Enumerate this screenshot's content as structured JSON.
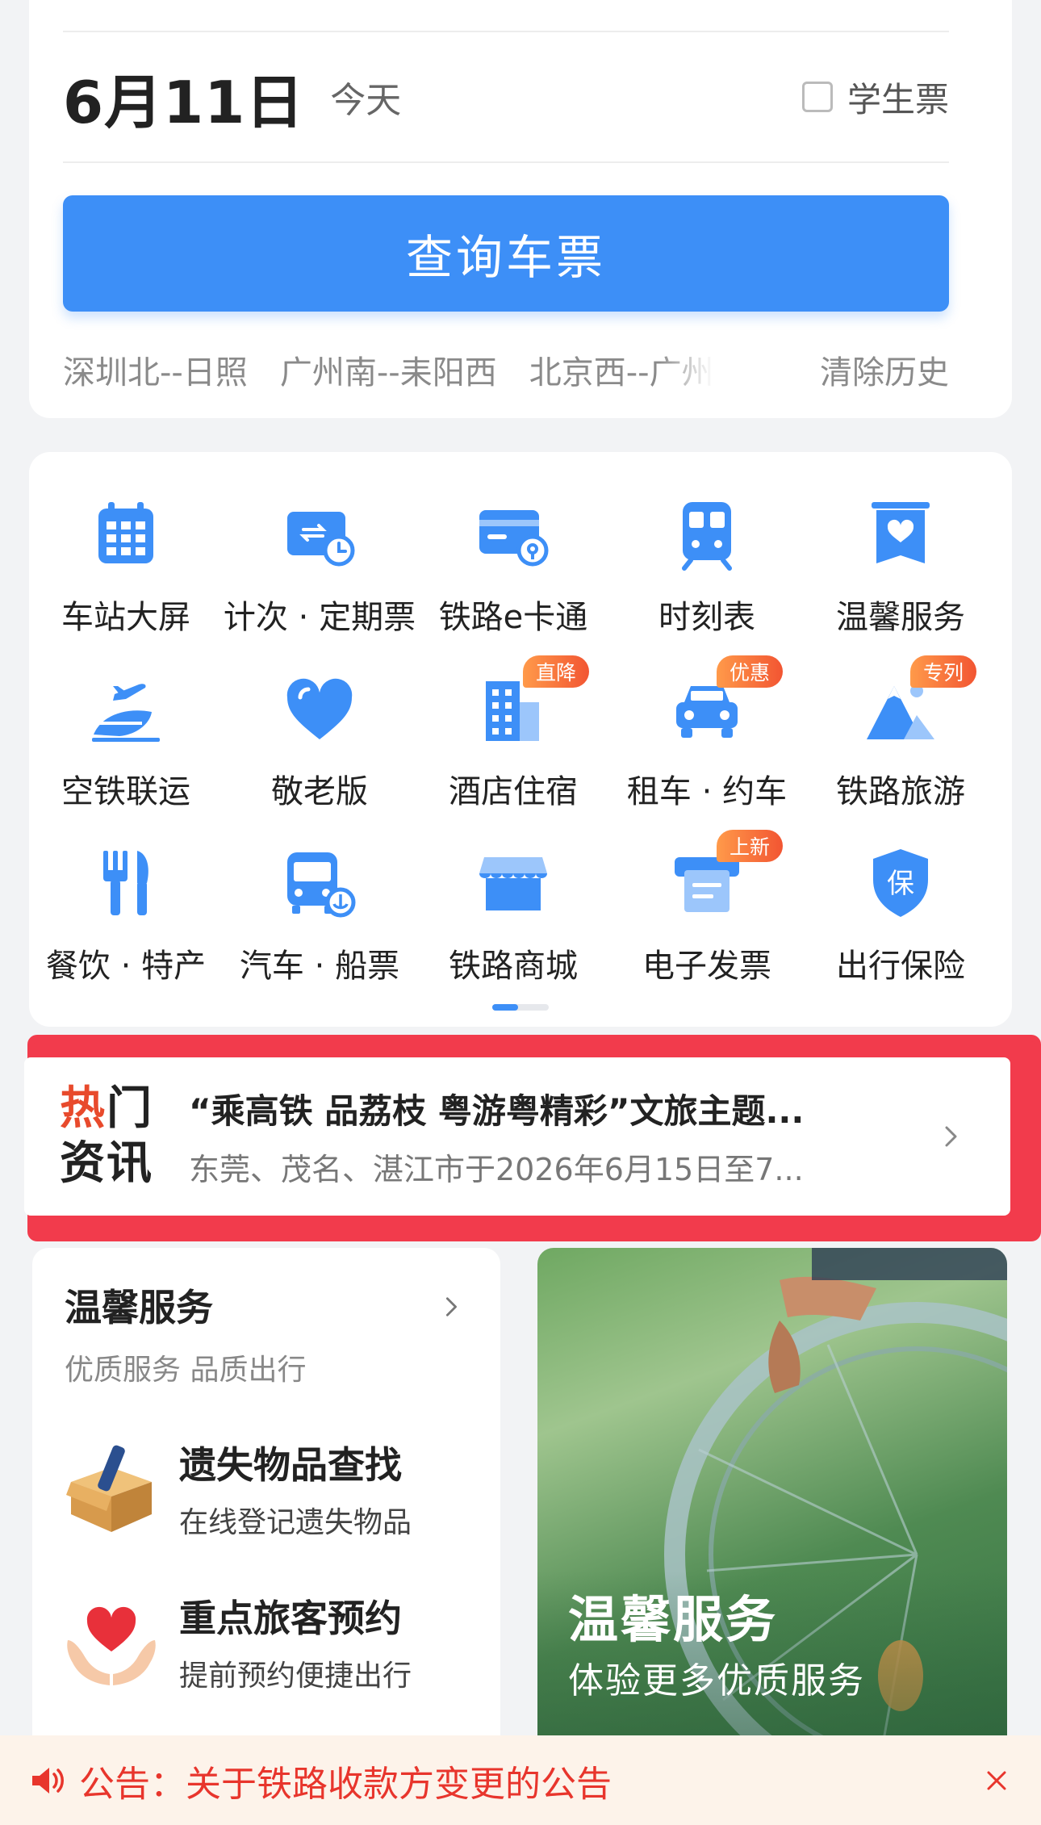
{
  "search_card": {
    "date": "6月11日",
    "date_hint": "今天",
    "student_ticket_label": "学生票",
    "student_ticket_checked": false,
    "search_button": "查询车票",
    "history": [
      "深圳北--日照",
      "广州南--耒阳西",
      "北京西--广州"
    ],
    "clear_history": "清除历史"
  },
  "service_grid": {
    "accent_color": "#3d8ff7",
    "items": [
      {
        "label": "车站大屏",
        "icon": "station-screen-icon"
      },
      {
        "label": "计次 · 定期票",
        "icon": "ticket-wallet-icon"
      },
      {
        "label": "铁路e卡通",
        "icon": "rail-ecard-icon"
      },
      {
        "label": "时刻表",
        "icon": "train-timetable-icon"
      },
      {
        "label": "温馨服务",
        "icon": "warm-service-icon"
      },
      {
        "label": "空铁联运",
        "icon": "air-rail-icon"
      },
      {
        "label": "敬老版",
        "icon": "heart-icon"
      },
      {
        "label": "酒店住宿",
        "icon": "hotel-icon",
        "tag": "直降"
      },
      {
        "label": "租车 · 约车",
        "icon": "car-icon",
        "tag": "优惠"
      },
      {
        "label": "铁路旅游",
        "icon": "mountain-icon",
        "tag": "专列"
      },
      {
        "label": "餐饮 · 特产",
        "icon": "fork-knife-icon"
      },
      {
        "label": "汽车 · 船票",
        "icon": "bus-ship-icon"
      },
      {
        "label": "铁路商城",
        "icon": "shop-icon"
      },
      {
        "label": "电子发票",
        "icon": "invoice-icon",
        "tag": "上新"
      },
      {
        "label": "出行保险",
        "icon": "insurance-shield-icon",
        "shield_text": "保"
      }
    ],
    "page_indicator": {
      "current": 1,
      "total": 2
    }
  },
  "hot_news": {
    "badge_line1": "热门",
    "badge_line2": "资讯",
    "title": "“乘高铁 品荔枝 粤游粤精彩”文旅主题...",
    "description": "东莞、茂名、湛江市于2026年6月15日至7..."
  },
  "warm_service": {
    "title": "温馨服务",
    "subtitle": "优质服务 品质出行",
    "items": [
      {
        "title": "遗失物品查找",
        "desc": "在线登记遗失物品",
        "icon": "lost-box-icon"
      },
      {
        "title": "重点旅客预约",
        "desc": "提前预约便捷出行",
        "icon": "heart-hands-icon"
      }
    ]
  },
  "banner": {
    "title": "温馨服务",
    "subtitle": "体验更多优质服务"
  },
  "notice": {
    "text": "公告：关于铁路收款方变更的公告",
    "color": "#e8352c"
  }
}
